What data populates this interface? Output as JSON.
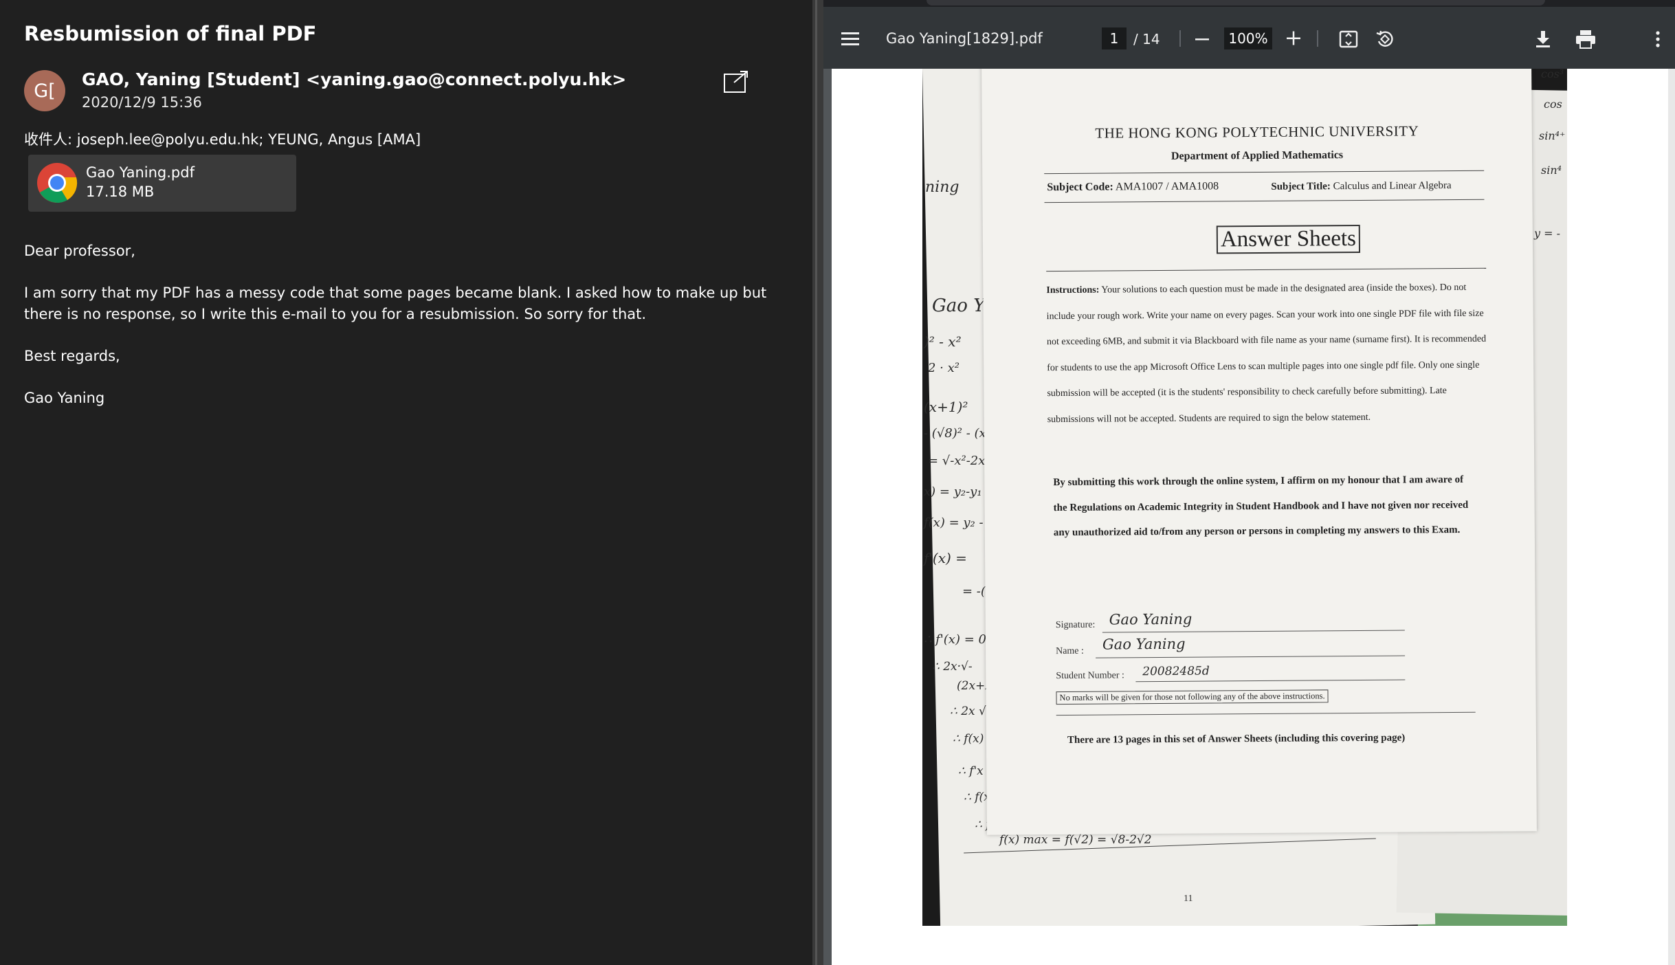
{
  "email": {
    "subject": "Resbumission of final PDF",
    "avatar_initials": "G[",
    "avatar_color": "#a86a58",
    "sender": "GAO, Yaning [Student] <yaning.gao@connect.polyu.hk>",
    "date": "2020/12/9 15:36",
    "recipients": "收件人: joseph.lee@polyu.edu.hk; YEUNG, Angus [AMA]",
    "attachment": {
      "name": "Gao Yaning.pdf",
      "size": "17.18 MB",
      "icon": "chrome-icon"
    },
    "body": {
      "greeting": "Dear professor,",
      "paragraph": "I am sorry that my PDF has a messy code that some pages became blank. I asked how to make up but there is no response, so I write this e-mail to you for a resubmission. So sorry for that.",
      "closing": "Best regards,",
      "signature": "Gao Yaning"
    }
  },
  "pdf_viewer": {
    "filename": "Gao Yaning[1829].pdf",
    "current_page": "1",
    "total_pages": "/ 14",
    "zoom": "100%",
    "toolbar_icons": [
      "menu-icon",
      "zoom-out-icon",
      "zoom-in-icon",
      "fit-page-icon",
      "rotate-icon",
      "download-icon",
      "print-icon",
      "more-icon"
    ]
  },
  "document": {
    "university": "THE HONG KONG POLYTECHNIC UNIVERSITY",
    "department": "Department of Applied Mathematics",
    "subject_code_label": "Subject Code:",
    "subject_code": "AMA1007 / AMA1008",
    "subject_title_label": "Subject Title:",
    "subject_title": "Calculus and Linear Algebra",
    "heading": "Answer Sheets",
    "instructions_label": "Instructions:",
    "instructions": "Your solutions to each question must be made in the designated area (inside the boxes). Do not include your rough work. Write your name on every pages. Scan your work into one single PDF file with file size not exceeding 6MB, and submit it via Blackboard with file name as your name (surname first). It is recommended for students to use the app Microsoft Office Lens to scan multiple pages into one single pdf file. Only one single submission will be accepted (it is the students' responsibility to check carefully before submitting). Late submissions will not be accepted. Students are required to sign the below statement.",
    "affirmation": "By submitting this work through the online system, I affirm on my honour that I am aware of the Regulations on Academic Integrity in Student Handbook and I have not given nor received any unauthorized aid to/from any person or persons in completing my answers to this Exam.",
    "signature_label": "Signature:",
    "signature_value": "Gao Yaning",
    "name_label": "Name :",
    "name_value": "Gao Yaning",
    "student_number_label": "Student Number :",
    "student_number_value": "20082485d",
    "warning": "No marks will be given for those not following any of the above instructions.",
    "pages_note": "There are 13 pages in this set of Answer Sheets (including this covering page)",
    "underlying_page_number": "11",
    "handwriting_left": [
      "ning",
      "Gao Y",
      ")² - x²",
      "2 · x²",
      "(x+1)²",
      "- (√8)² - (x+",
      "= √-x²-2x",
      "x) = y₂-y₁ =",
      "f(x) = y₂ - y₁",
      "f'(x) =",
      "= -(2",
      "∴ f'(x) = 0 .",
      "∴ 2x·√-",
      "(2x+2)",
      "∴ 2x √",
      "∴ f(x)",
      "∴ f'x",
      "∴ f(x",
      "∴ f",
      "f(x) max = f(√2) = √8-2√2"
    ],
    "handwriting_right": [
      "cos³",
      "cos",
      "sin⁴⁺",
      "sin⁴",
      "y = -"
    ]
  }
}
